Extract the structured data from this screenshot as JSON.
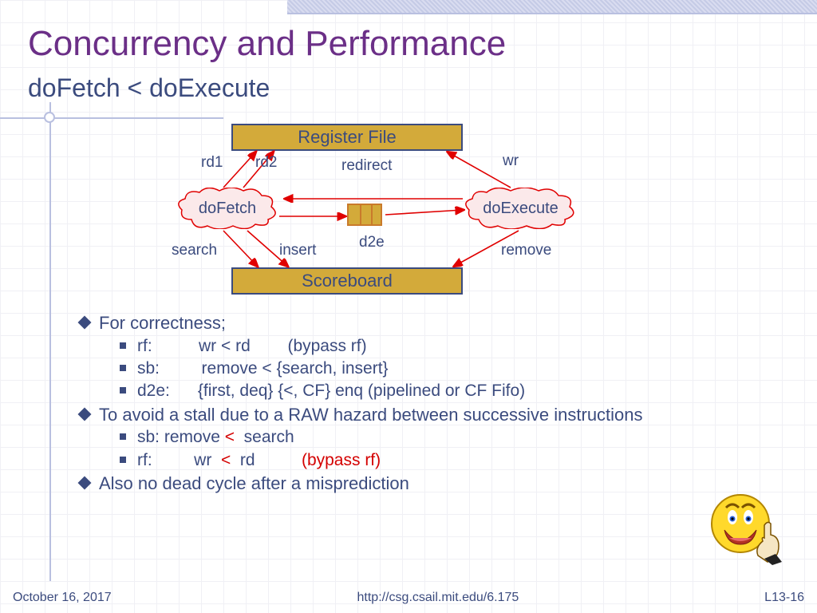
{
  "title": "Concurrency and Performance",
  "subtitle": "doFetch < doExecute",
  "diagram": {
    "register_file": "Register File",
    "scoreboard": "Scoreboard",
    "doFetch": "doFetch",
    "doExecute": "doExecute",
    "labels": {
      "rd1": "rd1",
      "rd2": "rd2",
      "redirect": "redirect",
      "wr": "wr",
      "search": "search",
      "insert": "insert",
      "remove": "remove",
      "d2e": "d2e"
    }
  },
  "bullets": {
    "b1": "For correctness;",
    "b1a": "rf:          wr < rd        (bypass rf)",
    "b1b": "sb:         remove < {search, insert}",
    "b1c": "d2e:      {first, deq} {<, CF} enq (pipelined or CF Fifo)",
    "b2": "To avoid a stall due to a RAW hazard between successive instructions",
    "b2a_pre": "sb: remove ",
    "b2a_lt": "<",
    "b2a_post": "  search",
    "b2b_pre": "rf:         wr  ",
    "b2b_lt": "<",
    "b2b_mid": "  rd          ",
    "b2b_bypass": "(bypass rf)",
    "b3": "Also no dead cycle after a misprediction"
  },
  "footer": {
    "date": "October 16, 2017",
    "url": "http://csg.csail.mit.edu/6.175",
    "page": "L13-16"
  }
}
